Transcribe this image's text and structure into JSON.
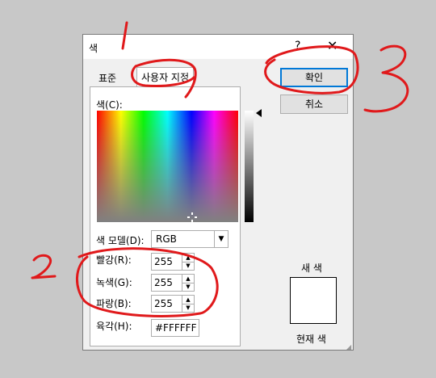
{
  "dialog": {
    "title": "색",
    "help_symbol": "?",
    "close_symbol": "✕",
    "tabs": [
      "표준",
      "사용자 지정"
    ],
    "colors_label": "색(C):",
    "color_model_label": "색 모델(D):",
    "color_model_value": "RGB",
    "red_label": "빨강(R):",
    "red_value": "255",
    "green_label": "녹색(G):",
    "green_value": "255",
    "blue_label": "파랑(B):",
    "blue_value": "255",
    "hex_label": "육각(H):",
    "hex_value": "#FFFFFF",
    "ok_label": "확인",
    "cancel_label": "취소",
    "new_color_label": "새 색",
    "current_color_label": "현재 색",
    "preview_color": "#FFFFFF"
  },
  "annotations": {
    "number_1": "1",
    "number_2": "2",
    "number_3": "3",
    "ink_color": "#e0191b"
  }
}
